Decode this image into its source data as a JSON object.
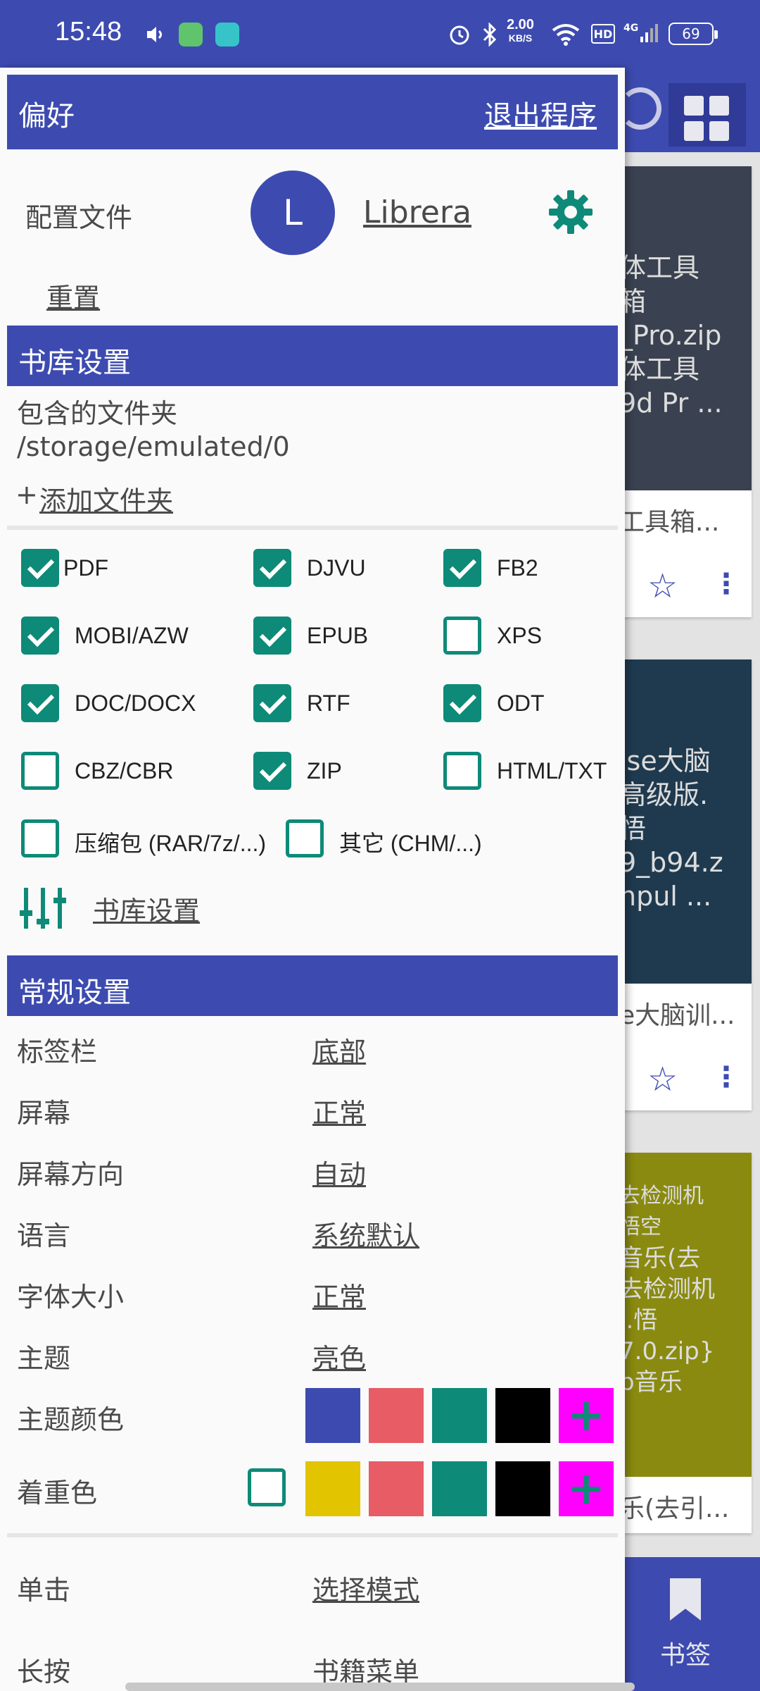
{
  "status_bar": {
    "time": "15:48",
    "net_speed": "2.00",
    "net_unit": "KB/S",
    "hd": "HD",
    "signal": "4G",
    "battery": "69"
  },
  "background": {
    "cards": [
      {
        "cover_text": [
          "体工具",
          "箱",
          "_Pro.zip",
          "体工具",
          "9d Pr ..."
        ],
        "cover_color": "#3a4150",
        "title": "工具箱..."
      },
      {
        "cover_text": [
          "lse大脑",
          "高级版.",
          "悟",
          "9_b94.z",
          "npul ..."
        ],
        "cover_color": "#1f3a4f",
        "title": "e大脑训..."
      },
      {
        "cover_text": [
          "去检测机",
          "悟空",
          "",
          "音乐(去",
          "去检测机",
          "l.悟",
          "7.0.zip}",
          "b音乐"
        ],
        "cover_color": "#8a8a10",
        "title": "乐(去引..."
      }
    ],
    "bottom_label": "书签"
  },
  "drawer": {
    "header": {
      "title": "偏好",
      "exit": "退出程序"
    },
    "profile": {
      "label": "配置文件",
      "avatar_letter": "L",
      "name": "Librera",
      "reset": "重置"
    },
    "library": {
      "header": "书库设置",
      "folders_label": "包含的文件夹",
      "folder_path": "/storage/emulated/0",
      "add_prefix": "+",
      "add_folder": "添加文件夹",
      "formats": [
        {
          "label": "PDF",
          "checked": true
        },
        {
          "label": "DJVU",
          "checked": true
        },
        {
          "label": "FB2",
          "checked": true
        },
        {
          "label": "MOBI/AZW",
          "checked": true
        },
        {
          "label": "EPUB",
          "checked": true
        },
        {
          "label": "XPS",
          "checked": false
        },
        {
          "label": "DOC/DOCX",
          "checked": true
        },
        {
          "label": "RTF",
          "checked": true
        },
        {
          "label": "ODT",
          "checked": true
        },
        {
          "label": "CBZ/CBR",
          "checked": false
        },
        {
          "label": "ZIP",
          "checked": true
        },
        {
          "label": "HTML/TXT",
          "checked": false
        },
        {
          "label": "压缩包 (RAR/7z/...)",
          "checked": false
        },
        {
          "label": "其它 (CHM/...)",
          "checked": false
        }
      ],
      "settings_link": "书库设置"
    },
    "general": {
      "header": "常规设置",
      "rows": [
        {
          "label": "标签栏",
          "value": "底部"
        },
        {
          "label": "屏幕",
          "value": "正常"
        },
        {
          "label": "屏幕方向",
          "value": "自动"
        },
        {
          "label": "语言",
          "value": "系统默认"
        },
        {
          "label": "字体大小",
          "value": "正常"
        },
        {
          "label": "主题",
          "value": "亮色"
        }
      ],
      "theme_color_label": "主题颜色",
      "theme_colors": [
        "#3d4bb0",
        "#e85c66",
        "#0e8a78",
        "#000000"
      ],
      "accent_label": "着重色",
      "accent_checked": false,
      "accent_colors": [
        "#e2c400",
        "#e85c66",
        "#0e8a78",
        "#000000"
      ],
      "plus": "+",
      "click_label": "单击",
      "click_value": "选择模式",
      "longpress_label": "长按",
      "longpress_value": "书籍菜单"
    }
  }
}
